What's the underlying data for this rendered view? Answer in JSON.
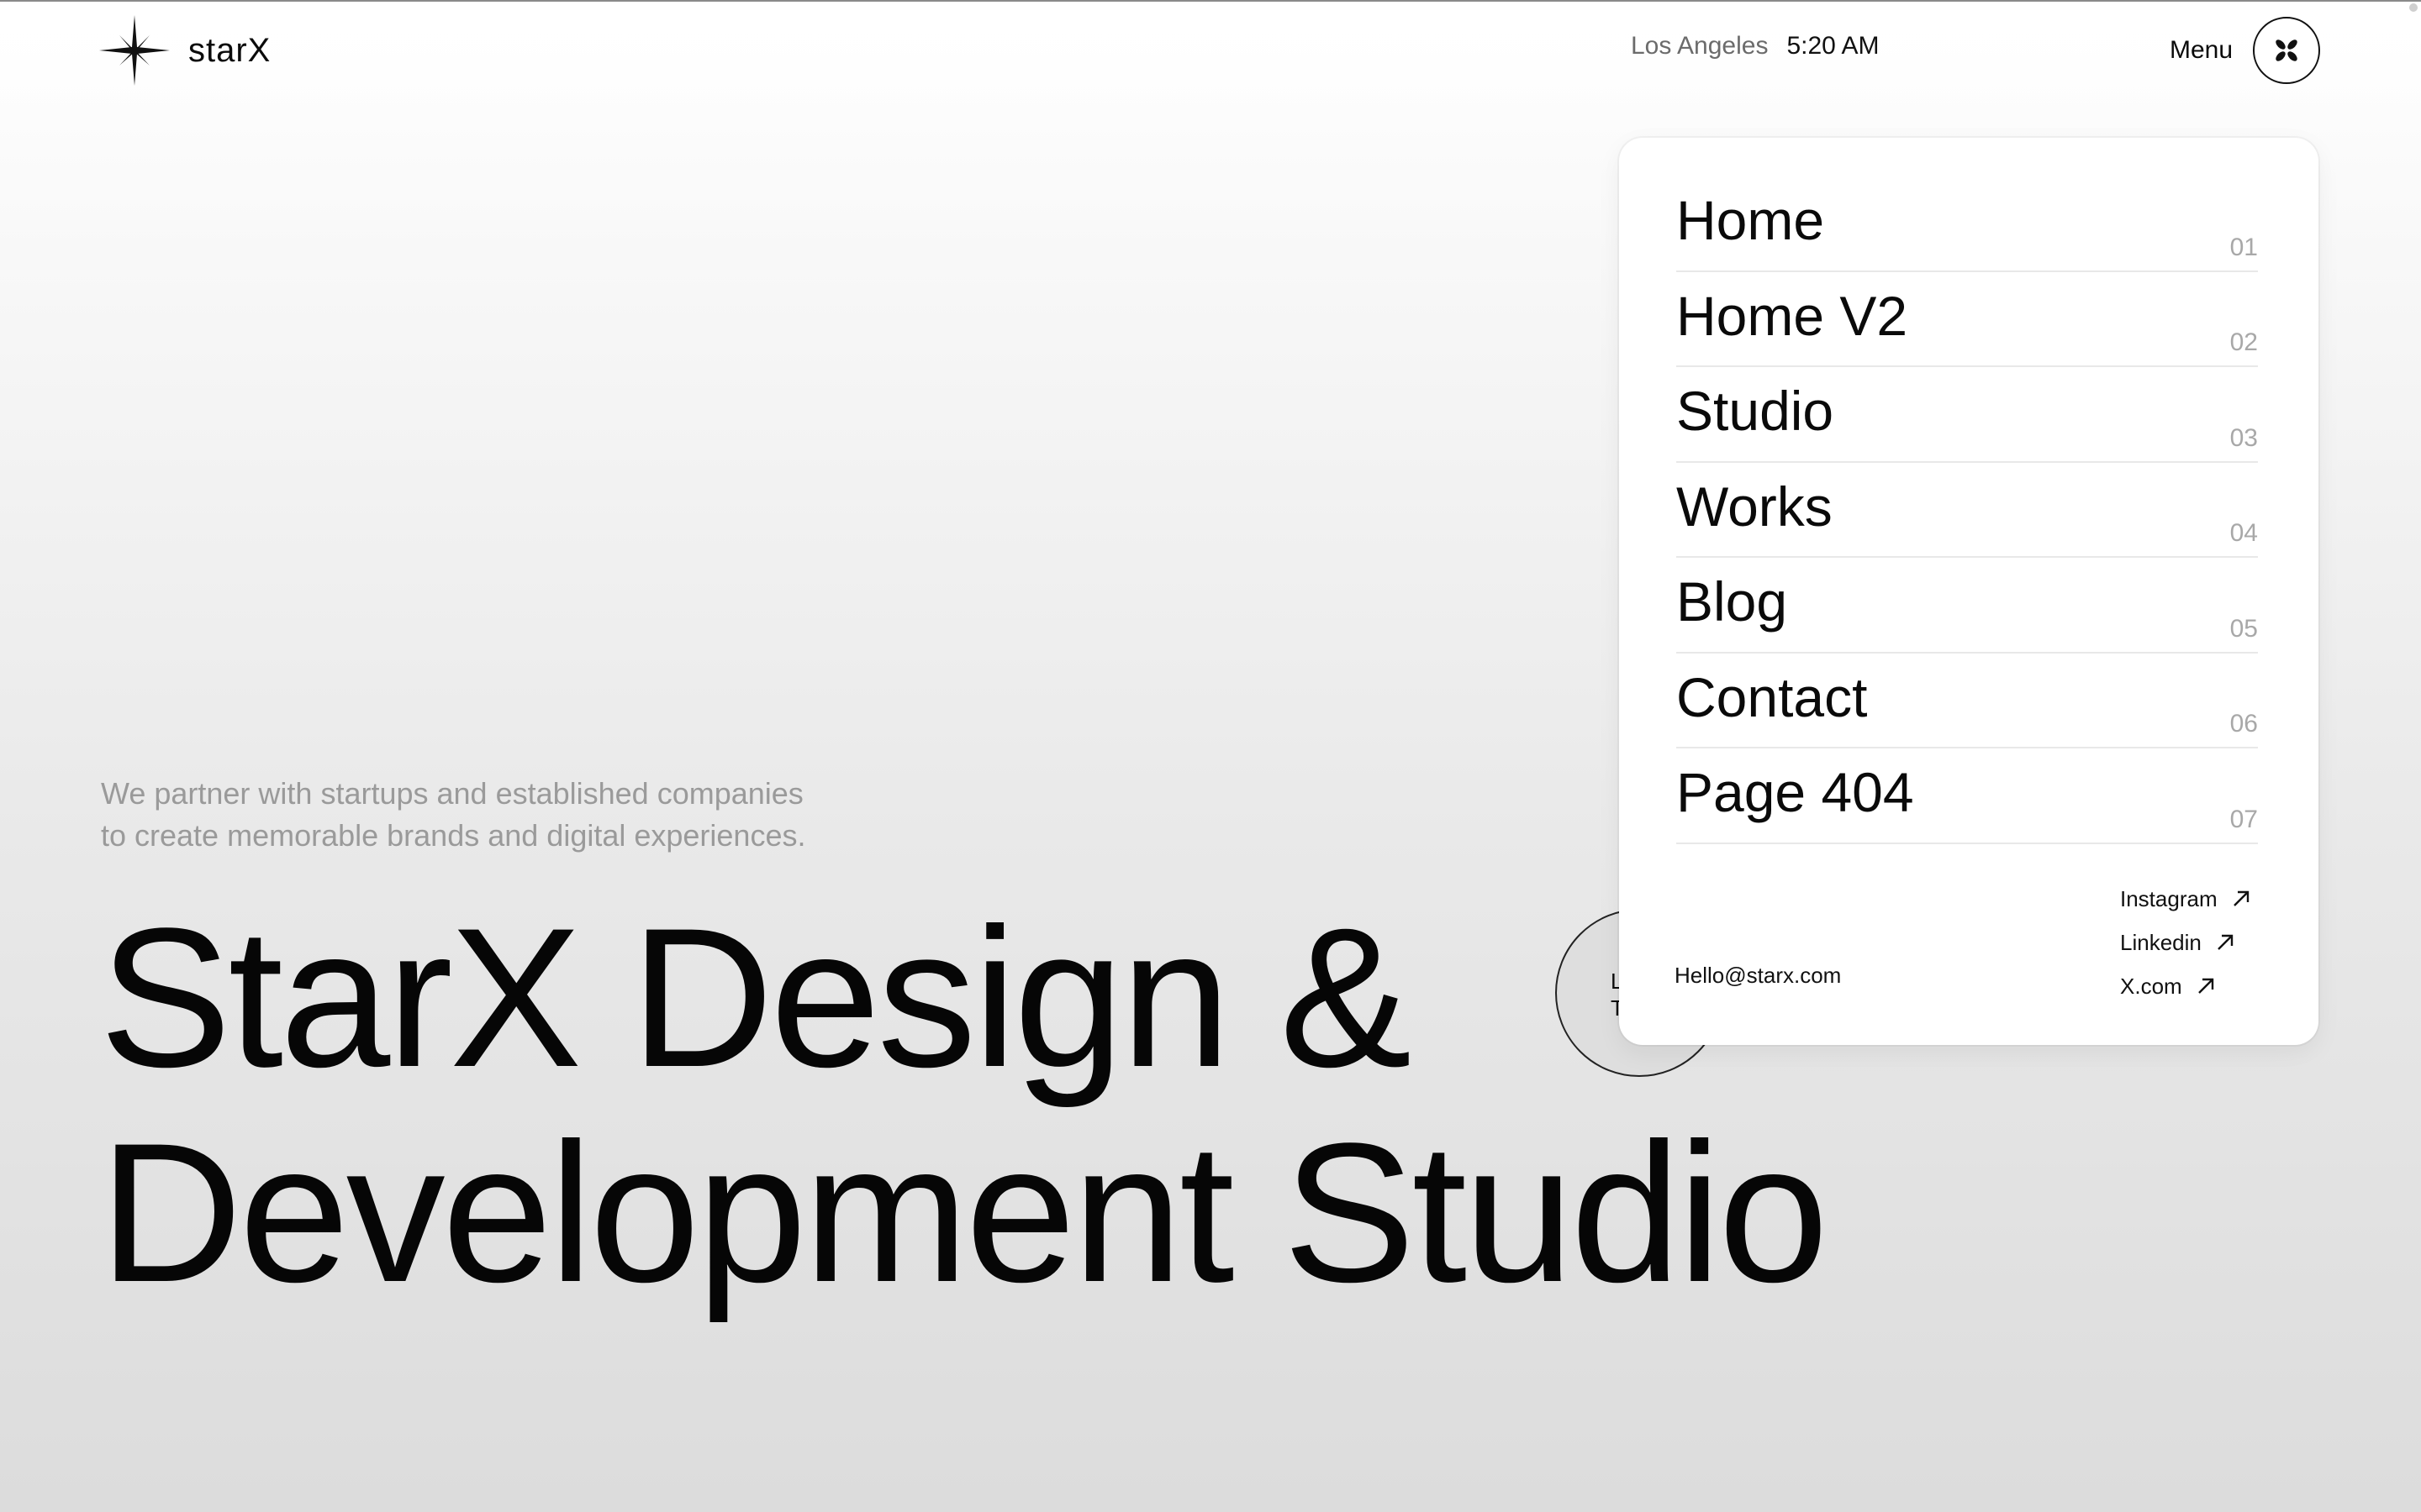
{
  "brand": {
    "logo_text": "starX",
    "icon": "star-burst-icon"
  },
  "clock": {
    "city": "Los Angeles",
    "time": "5:20 AM"
  },
  "menu": {
    "label": "Menu",
    "icon": "four-petal-close-icon"
  },
  "hero": {
    "intro_line1": "We partner with startups and established companies",
    "intro_line2": "to create memorable brands and digital experiences.",
    "headline_line1": "StarX Design &",
    "headline_line2": "Development Studio",
    "cta_partial_line1": "L",
    "cta_partial_line2": "T"
  },
  "nav": {
    "items": [
      {
        "label": "Home",
        "num": "01"
      },
      {
        "label": "Home V2",
        "num": "02"
      },
      {
        "label": "Studio",
        "num": "03"
      },
      {
        "label": "Works",
        "num": "04"
      },
      {
        "label": "Blog",
        "num": "05"
      },
      {
        "label": "Contact",
        "num": "06"
      },
      {
        "label": "Page 404",
        "num": "07"
      }
    ]
  },
  "contact": {
    "email": "Hello@starx.com"
  },
  "socials": [
    {
      "label": "Instagram",
      "icon": "arrow-up-right-icon"
    },
    {
      "label": "Linkedin",
      "icon": "arrow-up-right-icon"
    },
    {
      "label": "X.com",
      "icon": "arrow-up-right-icon"
    }
  ],
  "colors": {
    "text": "#0b0b0b",
    "muted": "#9a9a9a",
    "panel_bg": "#ffffff",
    "bg_top": "#ffffff",
    "bg_bottom": "#dcdcdc"
  }
}
